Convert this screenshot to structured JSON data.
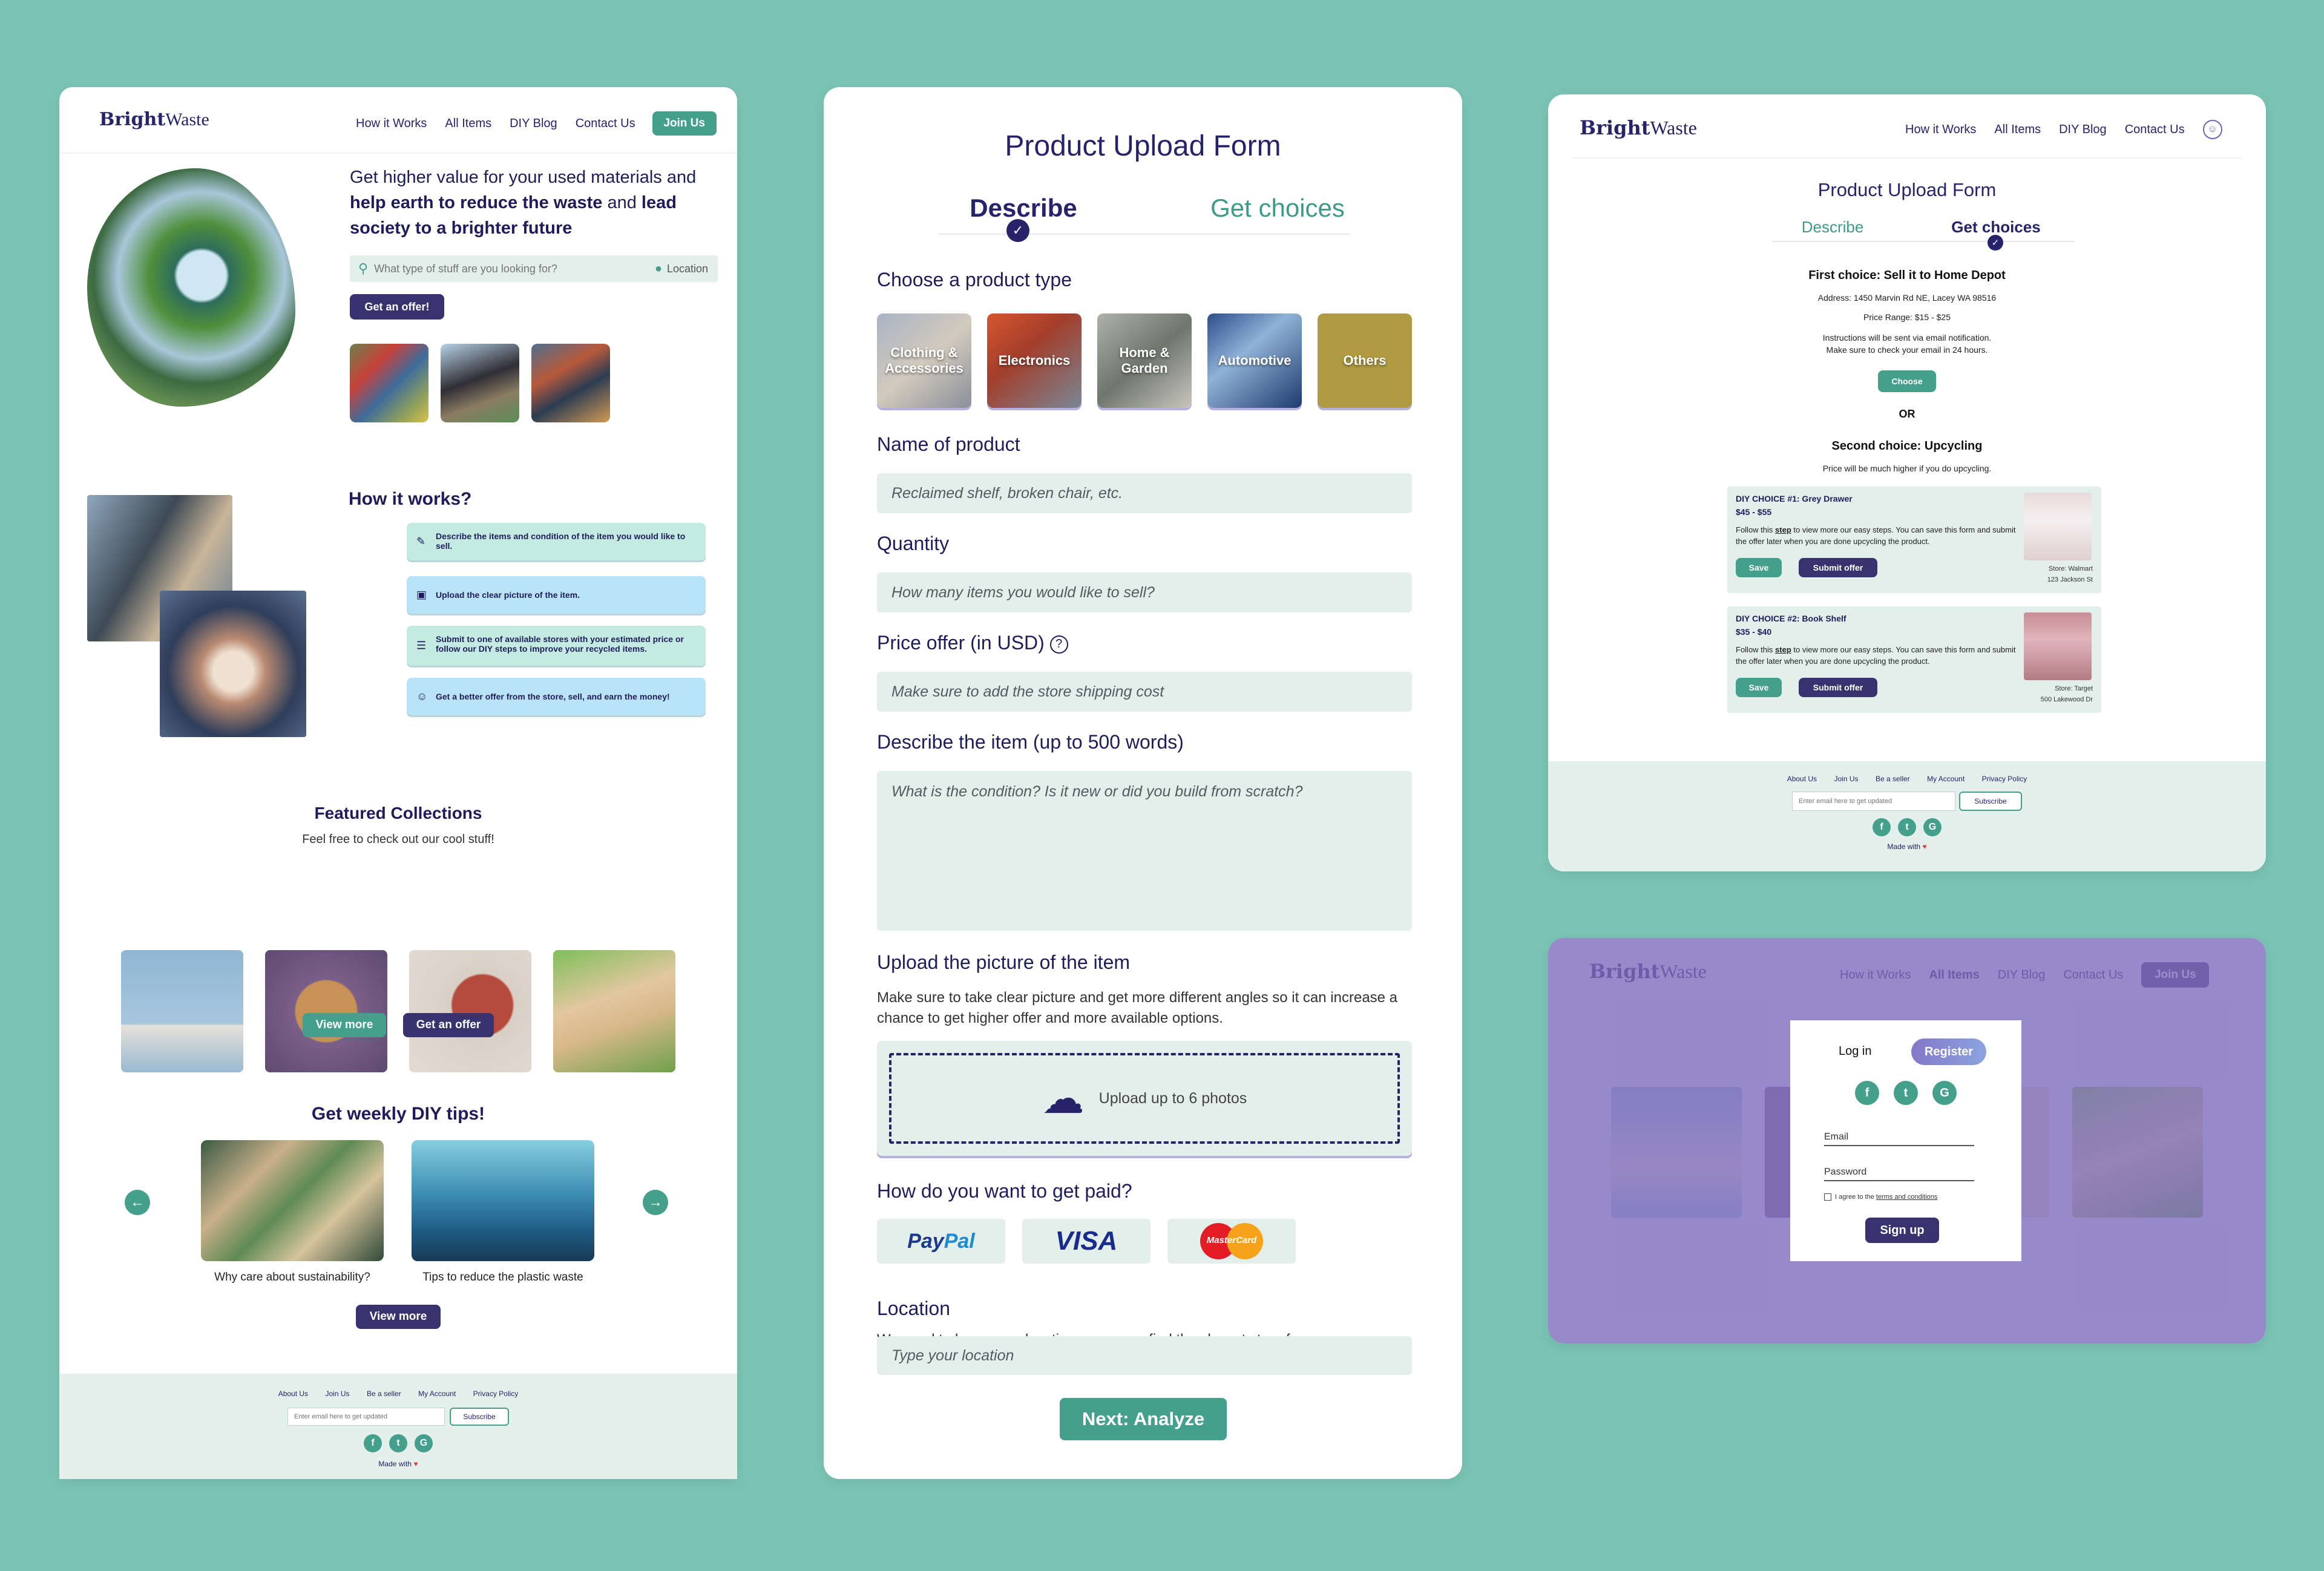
{
  "brand": {
    "bright": "Bright",
    "waste": "Waste"
  },
  "nav": {
    "how": "How it Works",
    "all": "All Items",
    "blog": "DIY Blog",
    "contact": "Contact Us",
    "join": "Join Us"
  },
  "home": {
    "hero_text": "Get higher value for your used materials and",
    "hero_bold1": "help earth to reduce the waste",
    "hero_and": "and",
    "hero_bold2": "lead society to a brighter future",
    "search_placeholder": "What type of stuff are you looking for?",
    "location": "Location",
    "offer_btn": "Get an offer!",
    "how_title": "How it works?",
    "steps": [
      "Describe the items and condition of the item you would like to sell.",
      "Upload the clear picture of the item.",
      "Submit to one of available stores with your estimated price or follow our DIY steps to improve your recycled items.",
      "Get a better offer from the store, sell, and earn the money!"
    ],
    "featured_title": "Featured Collections",
    "featured_sub": "Feel free to check out our cool stuff!",
    "view_more": "View more",
    "get_offer": "Get an offer",
    "tips_title": "Get weekly DIY tips!",
    "tip1": "Why care about sustainability?",
    "tip2": "Tips to reduce the plastic waste",
    "tips_view_more": "View more"
  },
  "footer": {
    "links": [
      "About Us",
      "Join Us",
      "Be a seller",
      "My Account",
      "Privacy Policy"
    ],
    "email_placeholder": "Enter email here to get updated",
    "subscribe": "Subscribe",
    "made_with": "Made with",
    "heart": "♥"
  },
  "upload": {
    "title": "Product Upload Form",
    "tab1": "Describe",
    "tab2": "Get choices",
    "choose_type": "Choose a product type",
    "types": [
      "Clothing & Accessories",
      "Electronics",
      "Home & Garden",
      "Automotive",
      "Others"
    ],
    "name_label": "Name of product",
    "name_ph": "Reclaimed shelf, broken chair, etc.",
    "qty_label": "Quantity",
    "qty_ph": "How many items you would like to sell?",
    "price_label": "Price offer (in USD)",
    "price_ph": "Make sure to add the store shipping cost",
    "desc_label": "Describe the item (up to 500 words)",
    "desc_ph": "What is the condition? Is it new or did you build from scratch?",
    "pic_label": "Upload the picture of the item",
    "pic_help": "Make sure to take clear picture and get more different angles so it can increase a chance to get higher offer and more available options.",
    "upload_text": "Upload up to 6 photos",
    "paid_label": "How do you want to get paid?",
    "paypal_p": "Pay",
    "paypal_pal": "Pal",
    "visa": "VISA",
    "mastercard": "MasterCard",
    "loc_label": "Location",
    "loc_help": "We need to know your location so we can find the closest store for you.",
    "loc_ph": "Type your location",
    "next": "Next: Analyze"
  },
  "choices": {
    "title": "Product Upload Form",
    "tab1": "Describe",
    "tab2": "Get choices",
    "first": "First choice: Sell it to Home Depot",
    "address": "Address: 1450 Marvin Rd NE, Lacey WA 98516",
    "range": "Price Range: $15 - $25",
    "instr1": "Instructions will be sent via email notification.",
    "instr2": "Make sure to check your email in 24 hours.",
    "choose": "Choose",
    "or": "OR",
    "second": "Second choice: Upcycling",
    "second_sub": "Price will be much higher if you do upcycling.",
    "diy": [
      {
        "title": "DIY CHOICE #1: Grey Drawer",
        "price": "$45 - $55",
        "text_a": "Follow this ",
        "step": "step",
        "text_b": " to view more our easy steps. You can save this form and submit the offer later when you are done upcycling the product.",
        "store1": "Store: Walmart",
        "store2": "123 Jackson St"
      },
      {
        "title": "DIY CHOICE #2: Book Shelf",
        "price": "$35 - $40",
        "text_a": "Follow this ",
        "step": "step",
        "text_b": " to view more our easy steps. You can save this form and submit the offer later when you are done upcycling the product.",
        "store1": "Store: Target",
        "store2": "500 Lakewood Dr"
      }
    ],
    "save": "Save",
    "submit": "Submit offer"
  },
  "modal": {
    "login": "Log in",
    "register": "Register",
    "email": "Email",
    "password": "Password",
    "agree": "I agree to the",
    "terms": "terms and conditions",
    "signup": "Sign up"
  },
  "colors": {
    "bg": "#7bc4b5",
    "teal": "#44a08d",
    "navy": "#26236b",
    "field": "#e3efeb"
  }
}
